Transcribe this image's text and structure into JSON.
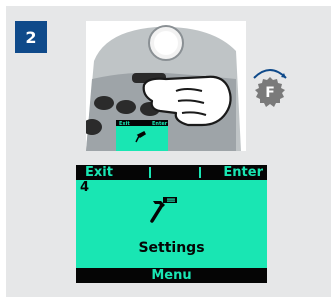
{
  "step": {
    "number": "2"
  },
  "device": {
    "key_label": "F",
    "mini_screen": {
      "left_softkey": "Exit",
      "right_softkey": "Enter"
    }
  },
  "lcd": {
    "left_softkey": "Exit",
    "middle_softkey": "",
    "right_softkey": "Enter",
    "menu_index": "4",
    "menu_title": "Settings",
    "bottom_softkey": "Menu",
    "icon": "hammer-icon"
  },
  "colors": {
    "panel_bg": "#e6e7e8",
    "badge_bg": "#0f4a8a",
    "lcd_bg": "#19e6b3",
    "lcd_ink": "#050505",
    "f_key": "#7a7a7a"
  }
}
